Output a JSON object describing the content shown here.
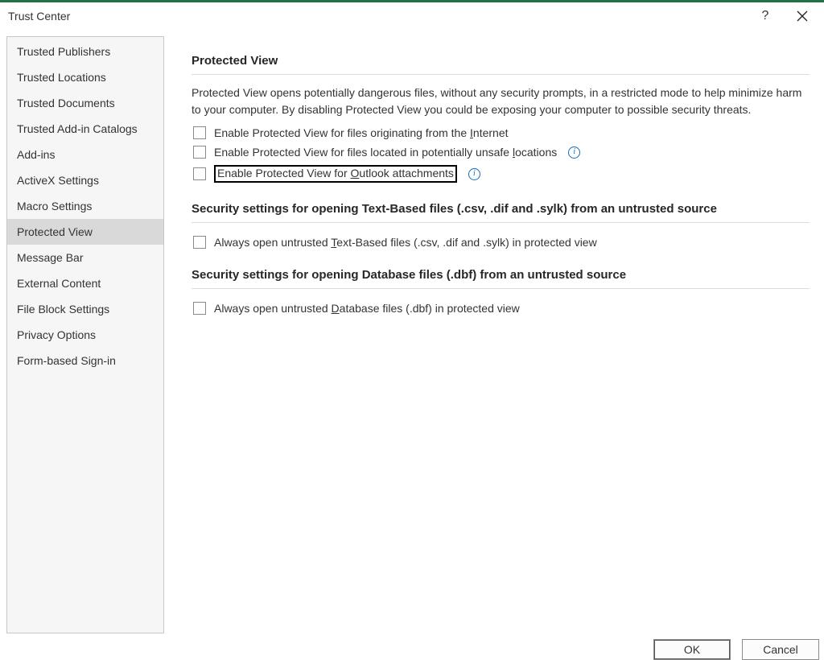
{
  "window": {
    "title": "Trust Center"
  },
  "sidebar": {
    "items": [
      "Trusted Publishers",
      "Trusted Locations",
      "Trusted Documents",
      "Trusted Add-in Catalogs",
      "Add-ins",
      "ActiveX Settings",
      "Macro Settings",
      "Protected View",
      "Message Bar",
      "External Content",
      "File Block Settings",
      "Privacy Options",
      "Form-based Sign-in"
    ],
    "selected_index": 7
  },
  "main": {
    "section1": {
      "title": "Protected View",
      "description": "Protected View opens potentially dangerous files, without any security prompts, in a restricted mode to help minimize harm to your computer. By disabling Protected View you could be exposing your computer to possible security threats.",
      "opt1_pre": "Enable Protected View for files originating from the ",
      "opt1_hot": "I",
      "opt1_post": "nternet",
      "opt2_pre": "Enable Protected View for files located in potentially unsafe ",
      "opt2_hot": "l",
      "opt2_post": "ocations",
      "opt3_pre": "Enable Protected View for ",
      "opt3_hot": "O",
      "opt3_post": "utlook attachments"
    },
    "section2": {
      "title": "Security settings for opening Text-Based files (.csv, .dif and .sylk) from an untrusted source",
      "opt_pre": "Always open untrusted ",
      "opt_hot": "T",
      "opt_post": "ext-Based files (.csv, .dif and .sylk) in protected view"
    },
    "section3": {
      "title": "Security settings for opening Database files (.dbf) from an untrusted source",
      "opt_pre": "Always open untrusted ",
      "opt_hot": "D",
      "opt_post": "atabase files (.dbf) in protected view"
    }
  },
  "footer": {
    "ok": "OK",
    "cancel": "Cancel"
  }
}
